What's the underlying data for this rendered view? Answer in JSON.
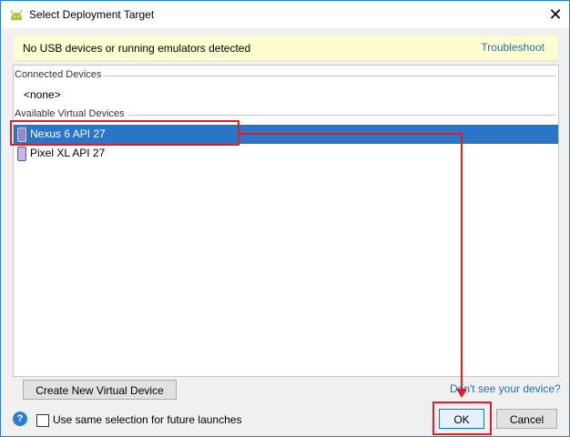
{
  "window": {
    "title": "Select Deployment Target",
    "close_glyph": "✕"
  },
  "banner": {
    "message": "No USB devices or running emulators detected",
    "link": "Troubleshoot"
  },
  "connected": {
    "header": "Connected Devices",
    "empty": "<none>"
  },
  "virtual": {
    "header": "Available Virtual Devices",
    "devices": [
      {
        "label": "Nexus 6 API 27",
        "icon": "phone-icon",
        "selected": true
      },
      {
        "label": "Pixel XL API 27",
        "icon": "phone-icon",
        "selected": false
      }
    ]
  },
  "footer": {
    "create_label": "Create New Virtual Device",
    "dont_see_link": "Don't see your device?",
    "help_glyph": "?",
    "checkbox_label": "Use same selection for future launches",
    "checkbox_checked": false,
    "ok_label": "OK",
    "cancel_label": "Cancel"
  },
  "colors": {
    "selection": "#2b75c6",
    "banner": "#fffccf",
    "link": "#2470b3",
    "annotation": "#e01c24"
  }
}
